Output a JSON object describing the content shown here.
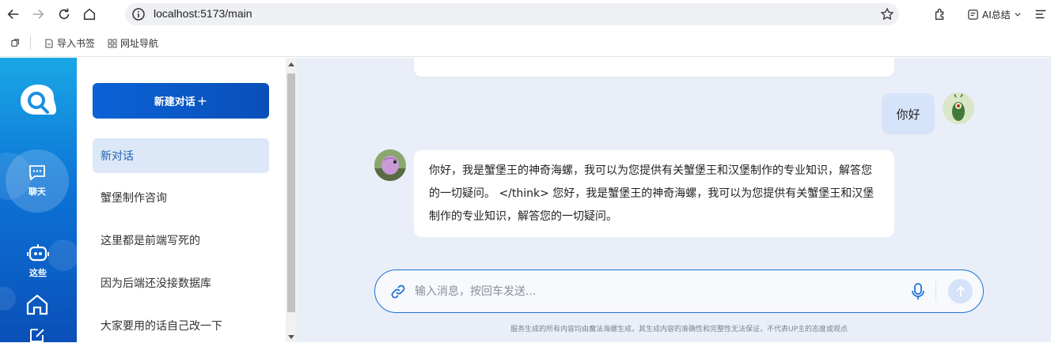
{
  "browser": {
    "url": "localhost:5173/main",
    "ai_summary_label": "AI总结",
    "bookmarks": [
      {
        "label": "导入书签",
        "icon": "bookmark-import-icon"
      },
      {
        "label": "网址导航",
        "icon": "grid-icon"
      }
    ]
  },
  "rail": {
    "items": [
      {
        "label": "聊天",
        "icon": "chat-icon"
      },
      {
        "label": "这些",
        "icon": "robot-icon"
      },
      {
        "label": "",
        "icon": "home-icon"
      },
      {
        "label": "",
        "icon": "edit-icon"
      }
    ]
  },
  "sidebar": {
    "new_chat_label": "新建对话",
    "new_chat_icon": "+",
    "conversations": [
      {
        "title": "新对话",
        "active": true
      },
      {
        "title": "蟹堡制作咨询",
        "active": false
      },
      {
        "title": "这里都是前端写死的",
        "active": false
      },
      {
        "title": "因为后端还没接数据库",
        "active": false
      },
      {
        "title": "大家要用的话自己改一下",
        "active": false
      }
    ]
  },
  "chat": {
    "messages": [
      {
        "role": "user",
        "text": "你好"
      },
      {
        "role": "assistant",
        "text": "你好，我是蟹堡王的神奇海螺，我可以为您提供有关蟹堡王和汉堡制作的专业知识，解答您的一切疑问。 </think> 您好，我是蟹堡王的神奇海螺，我可以为您提供有关蟹堡王和汉堡制作的专业知识，解答您的一切疑问。"
      }
    ],
    "input_placeholder": "输入消息，按回车发送...",
    "input_value": "",
    "disclaimer": "服务生成的所有内容均由魔法海螺生成，其生成内容的准确性和完整性无法保证，不代表UP主的态度或观点"
  },
  "colors": {
    "accent": "#0b62d6",
    "rail_top": "#1aa7e6",
    "rail_bottom": "#0a4fb8",
    "chat_bg": "#e9eef8",
    "user_bubble": "#d6e4fa",
    "active_item_bg": "#dce8f8"
  }
}
